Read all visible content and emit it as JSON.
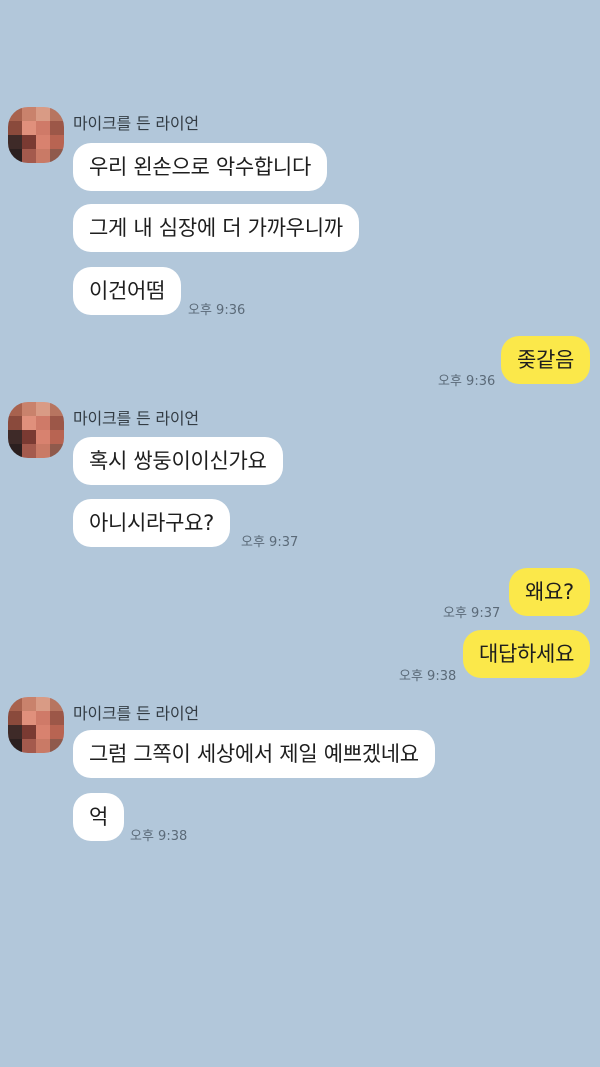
{
  "chat": {
    "messages": [
      {
        "sender": "마이크를 든 라이언",
        "text": "우리 왼손으로 악수합니다",
        "time": ""
      },
      {
        "sender": "",
        "text": "그게 내 심장에 더 가까우니까",
        "time": ""
      },
      {
        "sender": "",
        "text": "이건어떰",
        "time": "오후 9:36"
      },
      {
        "sender": "me",
        "text": "좆같음",
        "time": "오후 9:36"
      },
      {
        "sender": "마이크를 든 라이언",
        "text": "혹시 쌍둥이이신가요",
        "time": ""
      },
      {
        "sender": "",
        "text": "아니시라구요?",
        "time": "오후 9:37"
      },
      {
        "sender": "me",
        "text": "왜요?",
        "time": "오후 9:37"
      },
      {
        "sender": "me",
        "text": "대답하세요",
        "time": "오후 9:38"
      },
      {
        "sender": "마이크를 든 라이언",
        "text": "그럼 그쪽이 세상에서 제일 예쁘겠네요",
        "time": ""
      },
      {
        "sender": "",
        "text": "억",
        "time": "오후 9:38"
      }
    ]
  },
  "colors": {
    "background": "#b2c7da",
    "incoming_bubble": "#ffffff",
    "outgoing_bubble": "#fbe84a"
  },
  "icons": {
    "avatar": "pixelated-profile-avatar"
  }
}
